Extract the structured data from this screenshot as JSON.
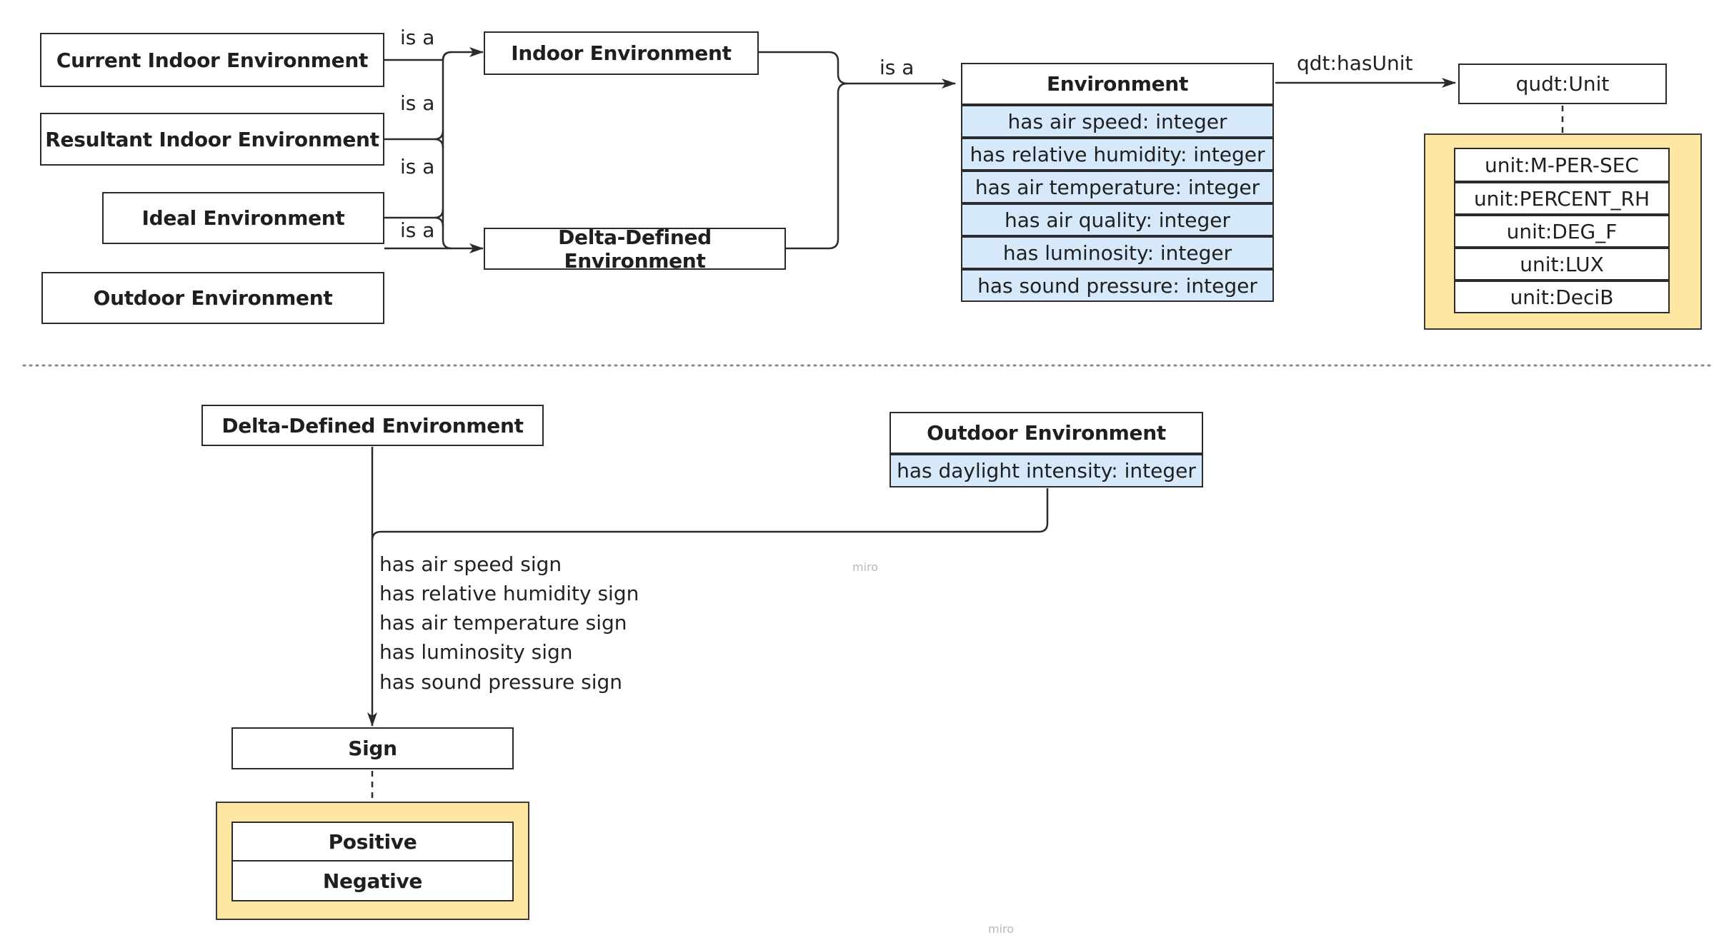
{
  "top": {
    "subclasses": [
      {
        "label": "Current Indoor Environment"
      },
      {
        "label": "Resultant Indoor Environment"
      },
      {
        "label": "Ideal Environment"
      },
      {
        "label": "Outdoor Environment"
      }
    ],
    "is_a_label": "is a",
    "intermediate": [
      {
        "label": "Indoor Environment"
      },
      {
        "label": "Delta-Defined Environment"
      }
    ],
    "environment": {
      "title": "Environment",
      "attributes": [
        "has air speed: integer",
        "has relative humidity: integer",
        "has air temperature: integer",
        "has air quality: integer",
        "has luminosity: integer",
        "has sound pressure: integer"
      ]
    },
    "has_unit_label": "qdt:hasUnit",
    "unit_class": "qudt:Unit",
    "unit_instances": [
      "unit:M-PER-SEC",
      "unit:PERCENT_RH",
      "unit:DEG_F",
      "unit:LUX",
      "unit:DeciB"
    ]
  },
  "bottom": {
    "delta": {
      "label": "Delta-Defined Environment"
    },
    "outdoor": {
      "title": "Outdoor Environment",
      "attributes": [
        "has daylight intensity: integer"
      ]
    },
    "sign_properties": [
      "has air speed sign",
      "has relative humidity sign",
      "has air temperature sign",
      "has luminosity sign",
      "has sound pressure sign"
    ],
    "sign_class": "Sign",
    "sign_instances": [
      "Positive",
      "Negative"
    ]
  },
  "watermarks": [
    "miro",
    "miro"
  ],
  "colors": {
    "attribute_fill": "#d6e9fa",
    "enum_fill": "#fde7a2",
    "stroke": "#2b2b2b"
  }
}
